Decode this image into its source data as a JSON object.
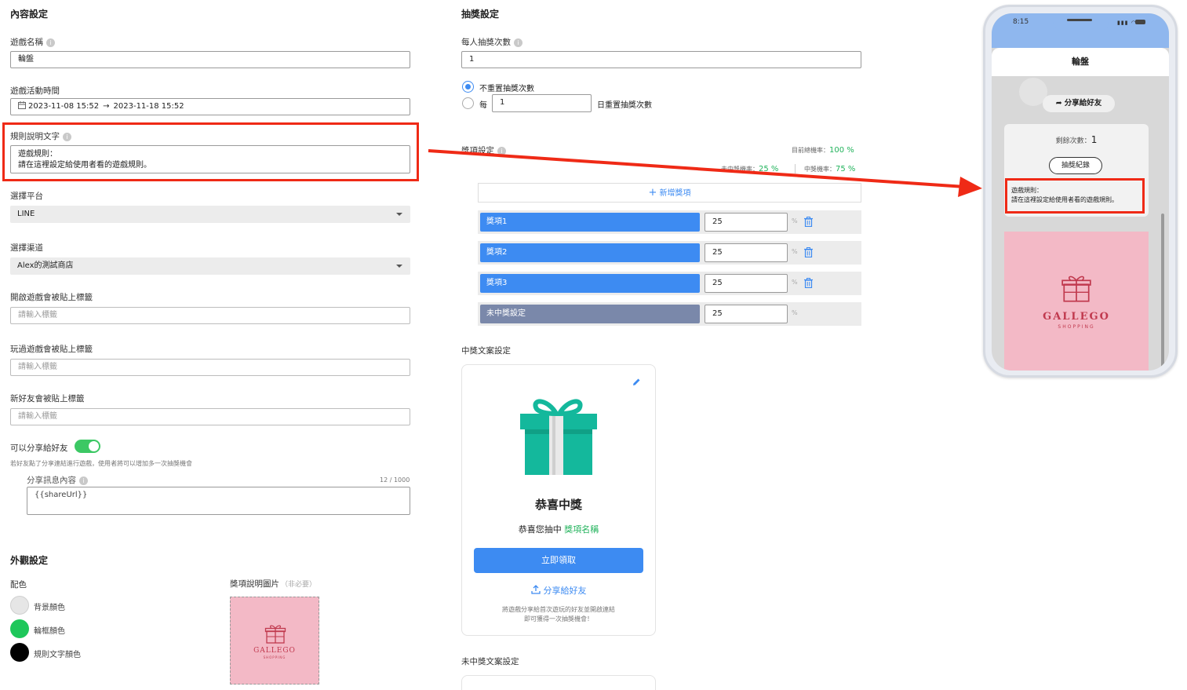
{
  "content_settings": {
    "title": "內容設定",
    "game_name": {
      "label": "遊戲名稱",
      "value": "輪盤"
    },
    "game_time": {
      "label": "遊戲活動時間",
      "start": "2023-11-08 15:52",
      "arrow": "→",
      "end": "2023-11-18 15:52"
    },
    "rules": {
      "label": "規則說明文字",
      "line1": "遊戲規則：",
      "line2": "請在這裡設定給使用者看的遊戲規則。"
    },
    "platform": {
      "label": "選擇平台",
      "value": "LINE"
    },
    "channel": {
      "label": "選擇渠道",
      "value": "Alex的測試商店"
    },
    "tag_open": {
      "label": "開啟遊戲會被貼上標籤",
      "placeholder": "請輸入標籤"
    },
    "tag_played": {
      "label": "玩過遊戲會被貼上標籤",
      "placeholder": "請輸入標籤"
    },
    "tag_new_friend": {
      "label": "新好友會被貼上標籤",
      "placeholder": "請輸入標籤"
    },
    "share": {
      "label": "可以分享給好友",
      "enabled": true,
      "hint": "若好友點了分享連結進行遊戲，使用者將可以增加多一次抽獎機會"
    },
    "share_message": {
      "label": "分享訊息內容",
      "count": "12 / 1000",
      "value": "{{shareUrl}}"
    }
  },
  "appearance": {
    "title": "外觀設定",
    "colors_label": "配色",
    "colors": [
      {
        "label": "背景顏色",
        "color": "#e6e6e6"
      },
      {
        "label": "輪框顏色",
        "color": "#1ec75a"
      },
      {
        "label": "規則文字顏色",
        "color": "#000000"
      }
    ],
    "prize_image": {
      "label": "獎項說明圖片",
      "optional": "（非必要）"
    }
  },
  "lottery": {
    "title": "抽獎設定",
    "draws": {
      "label": "每人抽獎次數",
      "value": "1"
    },
    "reset_options": {
      "no_reset": "不重置抽獎次數",
      "every": "每",
      "days_value": "1",
      "suffix": "日重置抽獎次數",
      "selected": "no_reset"
    }
  },
  "prizes": {
    "title": "獎項設定",
    "total_label": "目前總機率：",
    "total_value": "100 %",
    "lose_label": "未中獎機率：",
    "lose_value": "25 %",
    "win_label": "中獎機率：",
    "win_value": "75 %",
    "add_label": "新增獎項",
    "items": [
      {
        "name": "獎項1",
        "value": "25",
        "unit": "%"
      },
      {
        "name": "獎項2",
        "value": "25",
        "unit": "%"
      },
      {
        "name": "獎項3",
        "value": "25",
        "unit": "%"
      },
      {
        "name": "未中獎設定",
        "value": "25",
        "unit": "%"
      }
    ]
  },
  "win_copy": {
    "title": "中獎文案設定",
    "heading": "恭喜中獎",
    "subtitle_prefix": "恭喜您抽中",
    "subtitle_prize": "獎項名稱",
    "claim_button": "立即領取",
    "share_link": "分享給好友",
    "note_line1": "將遊戲分享給首次遊玩的好友並開啟連結",
    "note_line2": "即可獲得一次抽獎機會！"
  },
  "lose_copy": {
    "title": "未中獎文案設定"
  },
  "phone": {
    "time": "8:15",
    "title": "輪盤",
    "share_button": "分享給好友",
    "remaining_label": "剩餘次數：",
    "remaining_value": "1",
    "history_button": "抽獎紀錄",
    "rules_line1": "遊戲規則：",
    "rules_line2": "請在這裡設定給使用者看的遊戲規則。"
  },
  "brand": {
    "name": "GALLEGO",
    "sub": "SHOPPING"
  },
  "accent": {
    "blue": "#3d8bf2",
    "green": "#22b35c",
    "red": "#ef2a16",
    "teal": "#14b89c",
    "pink": "#f3b9c6"
  }
}
